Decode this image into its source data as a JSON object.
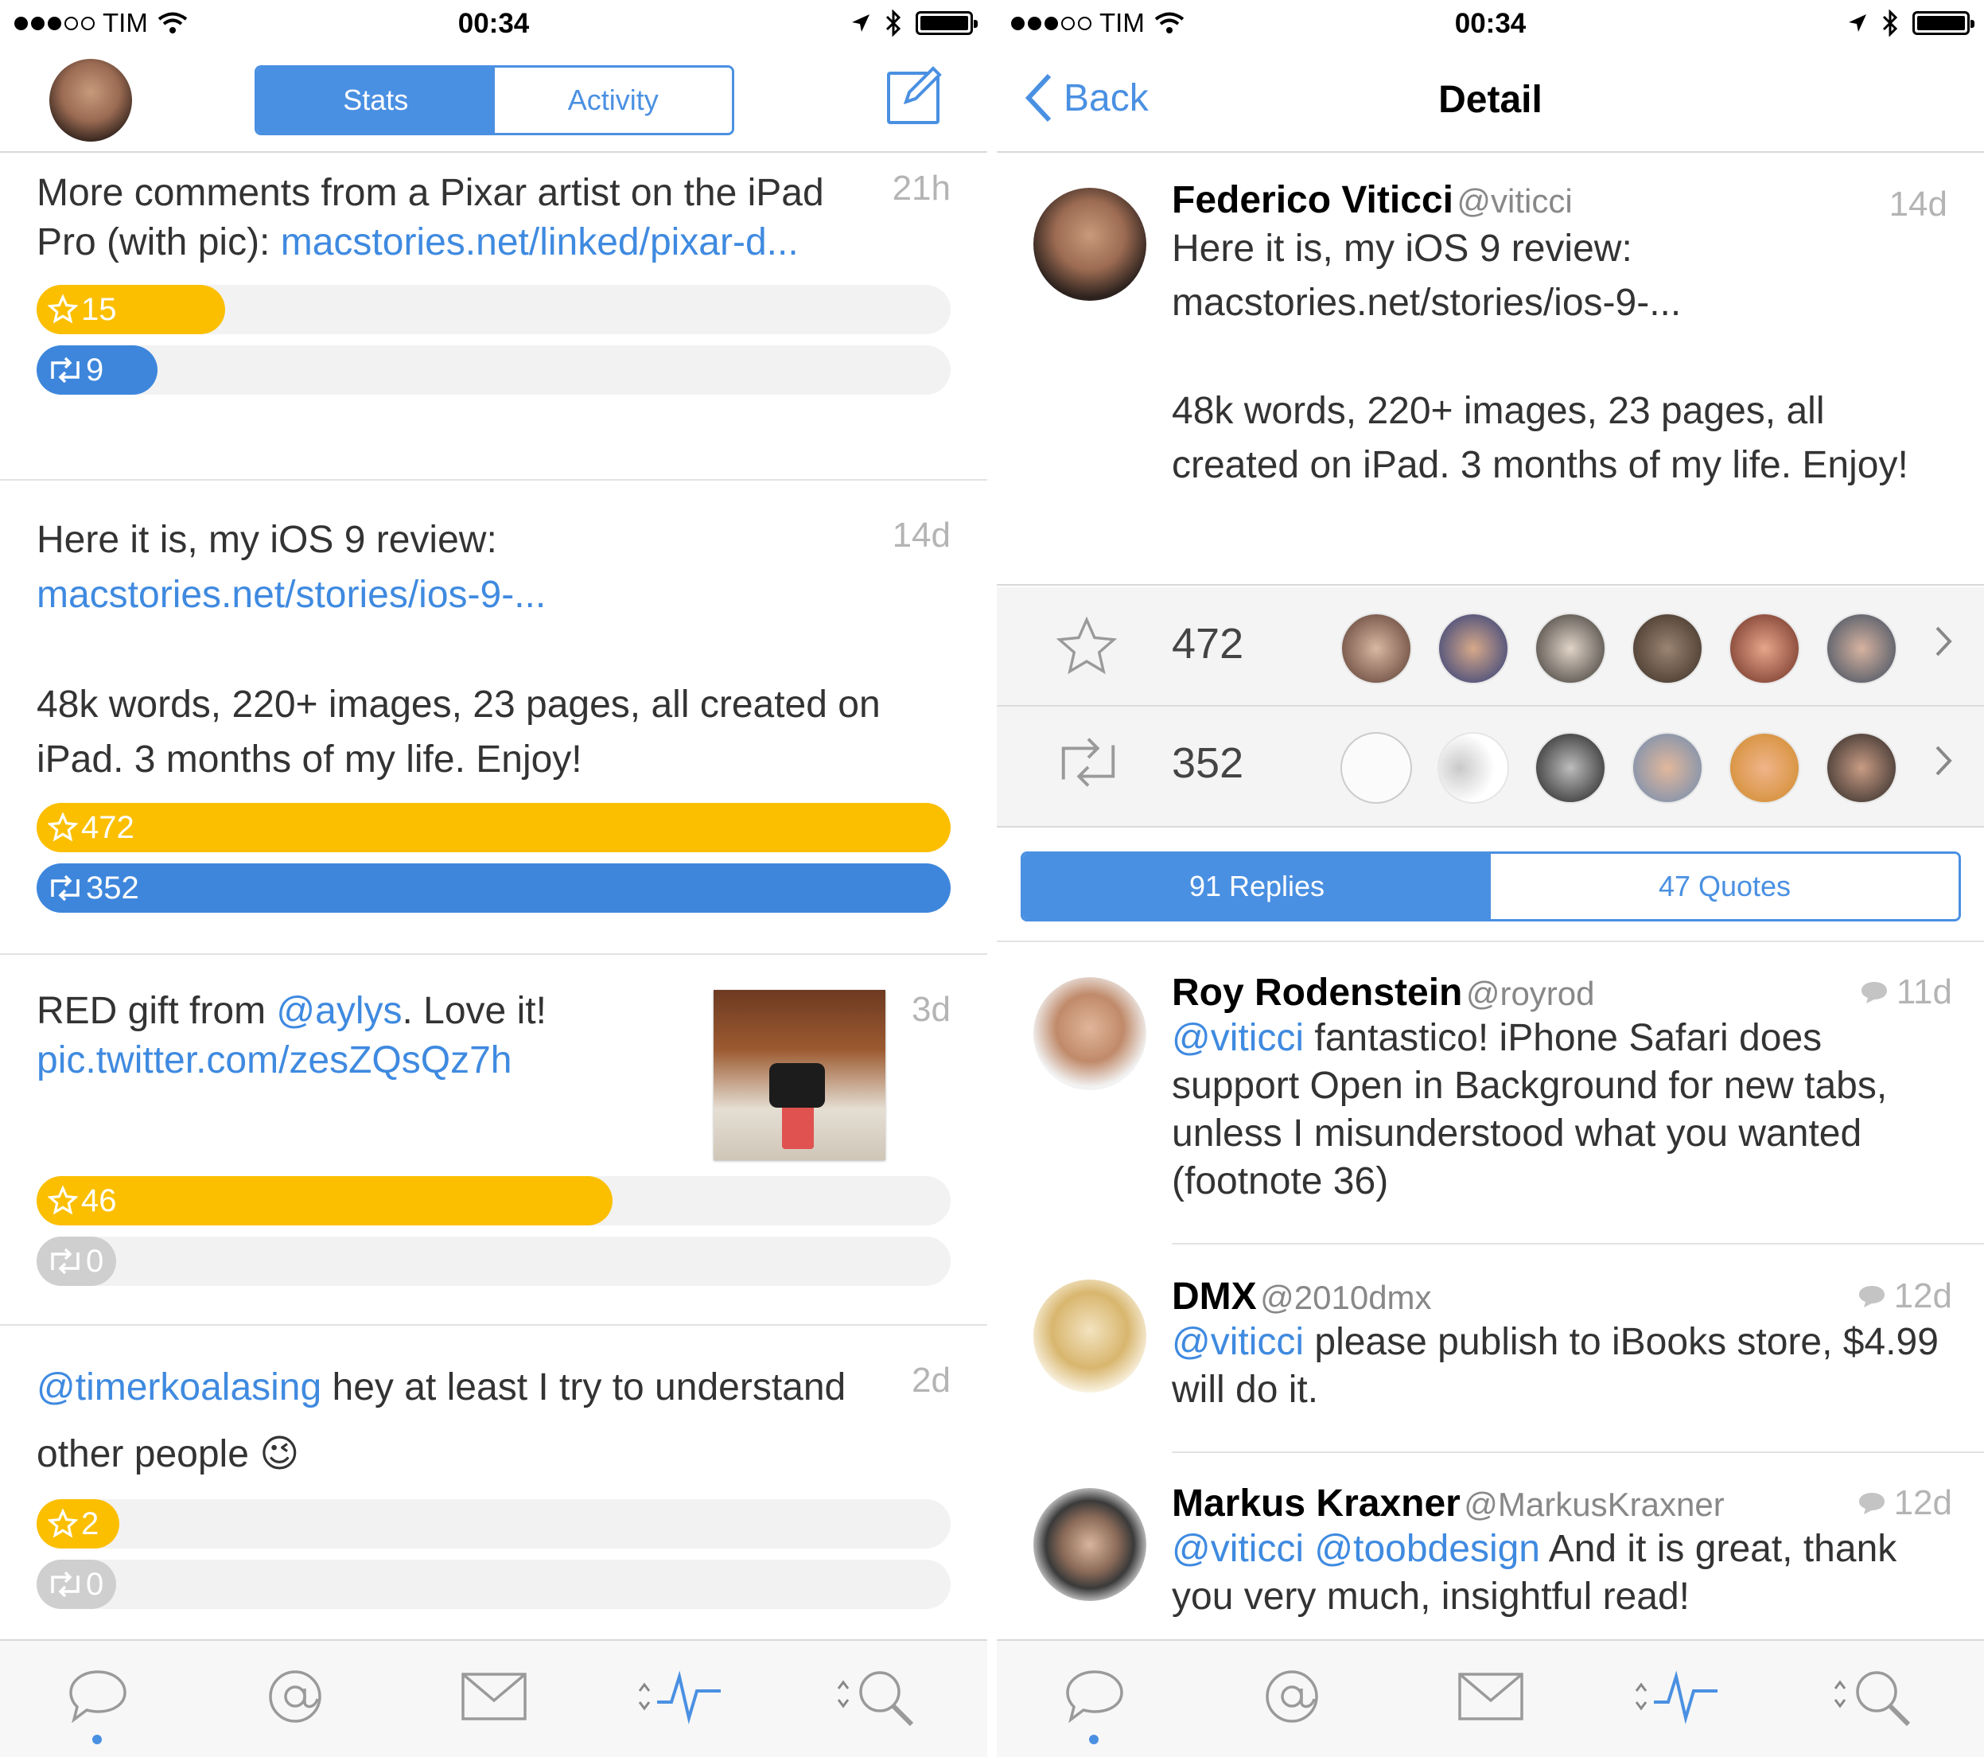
{
  "status": {
    "carrier": "TIM",
    "time": "00:34"
  },
  "left": {
    "segment": {
      "stats": "Stats",
      "activity": "Activity"
    },
    "tweets": [
      {
        "text": "More comments from a Pixar artist on the iPad Pro (with pic): ",
        "link": "macstories.net/linked/pixar-d...",
        "time": "21h",
        "favs": "15",
        "rts": "9",
        "fav_frac": 0.2,
        "rt_frac": 0.13
      },
      {
        "text": "Here it is, my iOS 9 review: ",
        "link": "macstories.net/stories/ios-9-...",
        "text2": "48k words, 220+ images, 23 pages, all created on iPad. 3 months of my life. Enjoy!",
        "time": "14d",
        "favs": "472",
        "rts": "352",
        "fav_frac": 1.0,
        "rt_frac": 1.0
      },
      {
        "text_a": "RED gift from ",
        "mention": "@aylys",
        "text_b": ". Love it!",
        "link": "pic.twitter.com/zesZQsQz7h",
        "time": "3d",
        "favs": "46",
        "rts": "0",
        "fav_frac": 0.63,
        "rt_frac": 0.0
      },
      {
        "mention": "@timerkoalasing",
        "text": " hey at least I try to understand other people ",
        "emoji": "😉",
        "time": "2d",
        "favs": "2",
        "rts": "0",
        "fav_frac": 0.0,
        "rt_frac": 0.0
      }
    ]
  },
  "right": {
    "back": "Back",
    "title": "Detail",
    "tweet": {
      "name": "Federico Viticci",
      "handle": "@viticci",
      "time": "14d",
      "line1": "Here it is, my iOS 9 review:",
      "link": "macstories.net/stories/ios-9-...",
      "text2": "48k words, 220+ images, 23 pages, all created on iPad. 3 months of my life. Enjoy!"
    },
    "favorites": "472",
    "retweets": "352",
    "segment": {
      "replies": "91 Replies",
      "quotes": "47 Quotes"
    },
    "replies": [
      {
        "name": "Roy Rodenstein",
        "handle": "@royrod",
        "time": "11d",
        "mention": "@viticci",
        "text": " fantastico! iPhone Safari does support Open in Background for new tabs, unless I misunderstood what you wanted (footnote 36)"
      },
      {
        "name": "DMX",
        "handle": "@2010dmx",
        "time": "12d",
        "mention": "@viticci",
        "text": " please publish to iBooks store, $4.99 will do it."
      },
      {
        "name": "Markus Kraxner",
        "handle": "@MarkusKraxner",
        "time": "12d",
        "mention": "@viticci",
        "mention2": "@toobdesign",
        "text": " And it is great, thank you very much, insightful read!"
      }
    ]
  },
  "colors": {
    "accent": "#4a90e2",
    "fav": "#fbbf00",
    "retweet": "#3d86dc",
    "link": "#3f8ae0"
  },
  "icons": [
    "signal-dots",
    "wifi-icon",
    "location-icon",
    "bluetooth-icon",
    "battery-icon",
    "compose-icon",
    "star-icon",
    "retweet-icon",
    "chevron-right-icon",
    "chat-bubble-icon",
    "at-icon",
    "mail-icon",
    "activity-icon",
    "search-icon"
  ]
}
